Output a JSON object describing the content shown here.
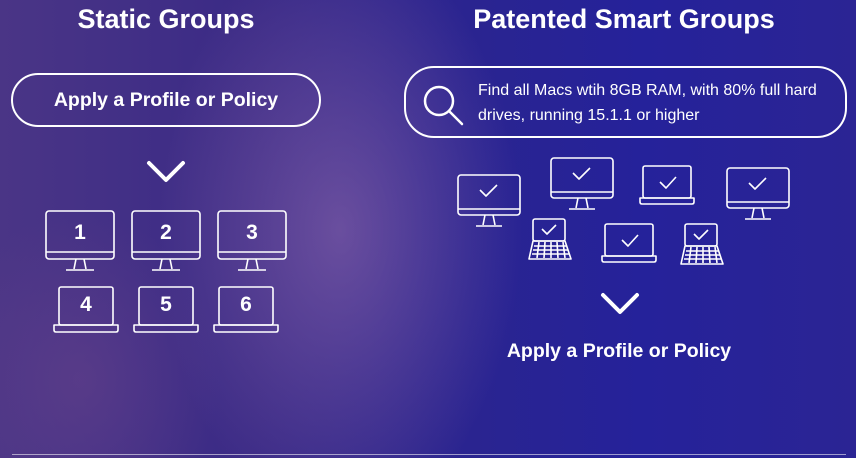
{
  "static_groups": {
    "title": "Static Groups",
    "action_label": "Apply a Profile or Policy",
    "devices": [
      {
        "type": "monitor",
        "label": "1"
      },
      {
        "type": "monitor",
        "label": "2"
      },
      {
        "type": "monitor",
        "label": "3"
      },
      {
        "type": "laptop",
        "label": "4"
      },
      {
        "type": "laptop",
        "label": "5"
      },
      {
        "type": "laptop",
        "label": "6"
      }
    ]
  },
  "smart_groups": {
    "title": "Patented Smart Groups",
    "query_text": "Find all Macs wtih 8GB RAM, with 80% full hard drives, running 15.1.1 or higher",
    "action_label": "Apply a Profile or Policy",
    "devices": [
      {
        "type": "monitor",
        "checked": true
      },
      {
        "type": "monitor",
        "checked": true
      },
      {
        "type": "laptop",
        "checked": true
      },
      {
        "type": "monitor",
        "checked": true
      },
      {
        "type": "laptop-keyboard",
        "checked": true
      },
      {
        "type": "laptop",
        "checked": true
      },
      {
        "type": "laptop-keyboard",
        "checked": true
      }
    ]
  },
  "icons": {
    "search": "search-icon",
    "chevron": "chevron-down-icon",
    "check": "checkmark-icon"
  },
  "colors": {
    "foreground": "#ffffff",
    "background_blue": "#2a2490",
    "background_purple": "#4a3586"
  }
}
